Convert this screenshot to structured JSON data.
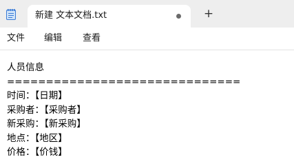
{
  "tab": {
    "title": "新建 文本文档.txt",
    "new_tab_label": "+"
  },
  "menu": {
    "items": [
      "文件",
      "编辑",
      "查看"
    ]
  },
  "document": {
    "lines": [
      "人员信息",
      "==============================",
      "时间：【日期】",
      "采购者：【采购者】",
      "新采购：【新采购】",
      "地点：【地区】",
      "价格：【价钱】"
    ]
  },
  "icons": {
    "app": "notepad-icon",
    "unsaved": "unsaved-dot-icon",
    "new_tab": "plus-icon"
  },
  "colors": {
    "tabbar_bg": "#eeeeee",
    "app_icon": "#3b7bd6"
  }
}
